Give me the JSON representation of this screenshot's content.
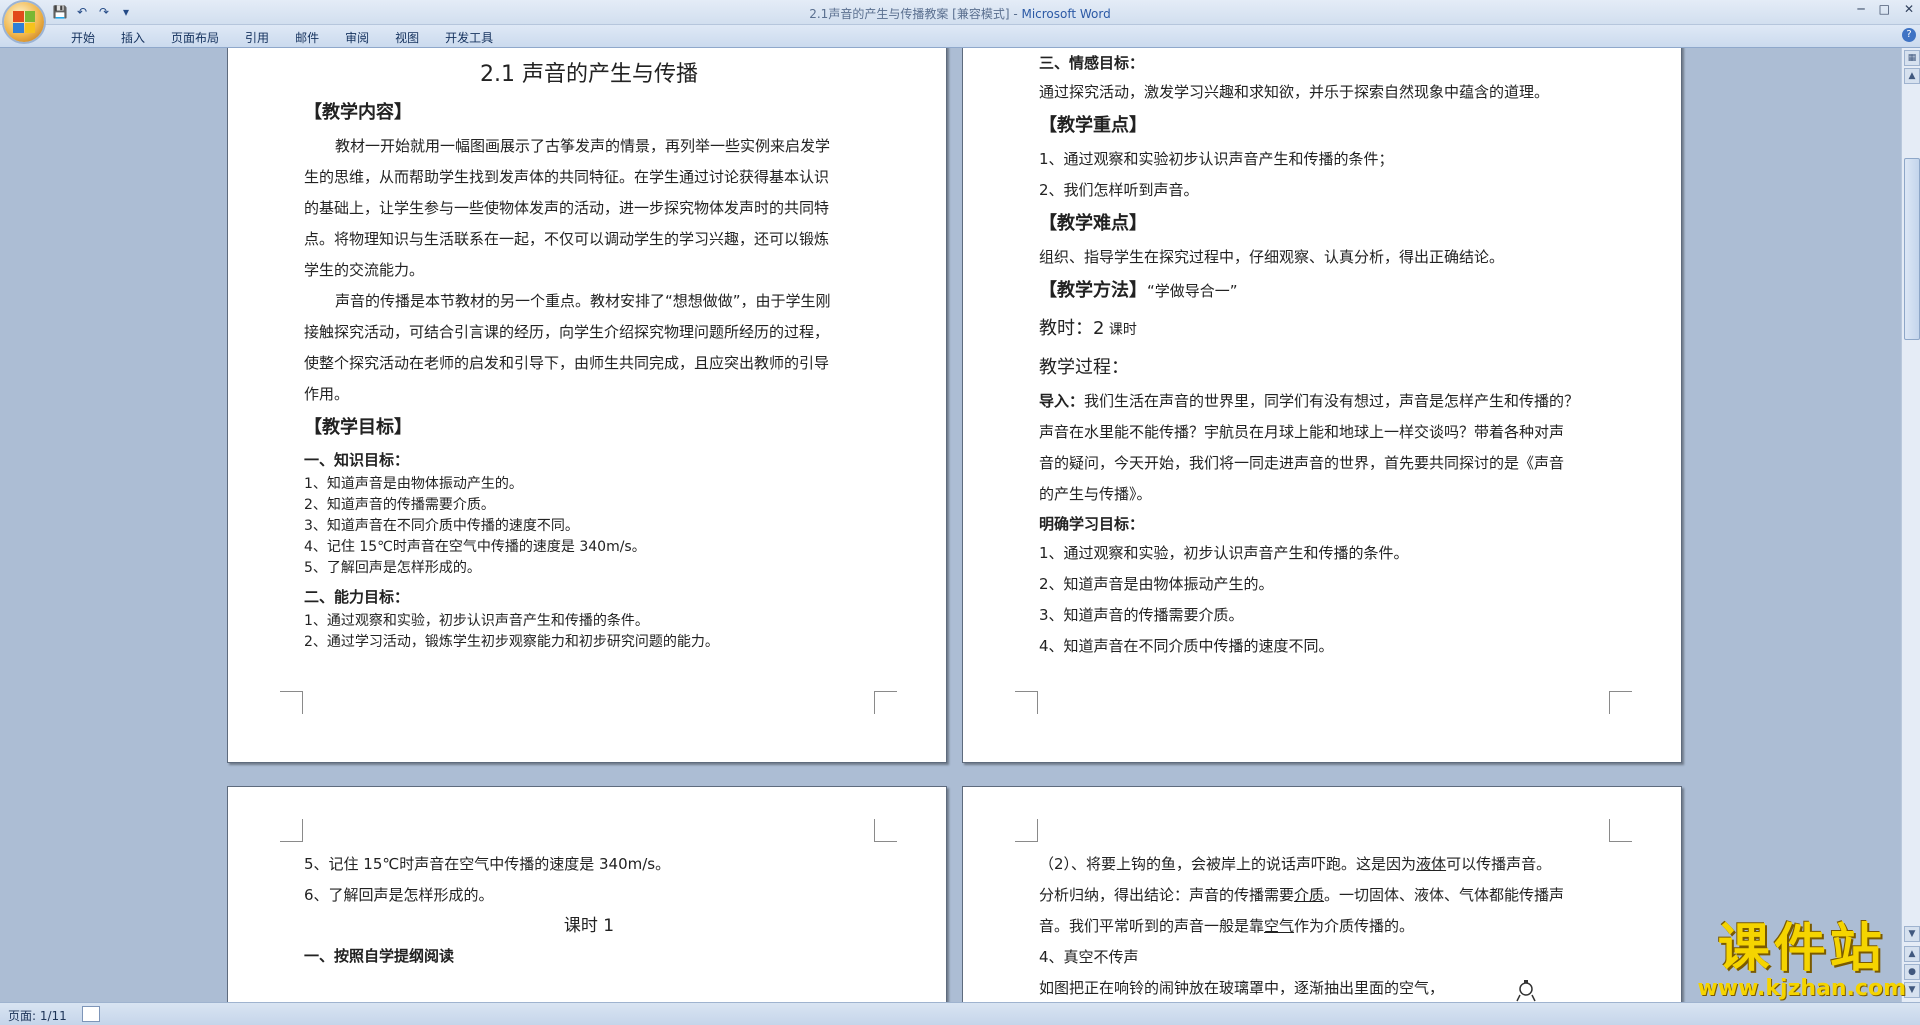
{
  "window": {
    "title": "2.1声音的产生与传播教案 [兼容模式]",
    "app_name": "Microsoft Word",
    "sep": " - "
  },
  "ribbon": {
    "tabs": [
      "开始",
      "插入",
      "页面布局",
      "引用",
      "邮件",
      "审阅",
      "视图",
      "开发工具"
    ]
  },
  "page1": {
    "title": "2.1  声音的产生与传播",
    "h_content": "【教学内容】",
    "para1": [
      "教材一开始就用一幅图画展示了古筝发声的情景，再列举一些实例来启发学",
      "生的思维，从而帮助学生找到发声体的共同特征。在学生通过讨论获得基本认识",
      "的基础上，让学生参与一些使物体发声的活动，进一步探究物体发声时的共同特",
      "点。将物理知识与生活联系在一起，不仅可以调动学生的学习兴趣，还可以锻炼",
      "学生的交流能力。"
    ],
    "para2": [
      "声音的传播是本节教材的另一个重点。教材安排了“想想做做”，由于学生刚",
      "接触探究活动，可结合引言课的经历，向学生介绍探究物理问题所经历的过程，",
      "使整个探究活动在老师的启发和引导下，由师生共同完成，且应突出教师的引导",
      "作用。"
    ],
    "h_goals": "【教学目标】",
    "sub1": "一、知识目标：",
    "knowledge": [
      "1、知道声音是由物体振动产生的。",
      "2、知道声音的传播需要介质。",
      "3、知道声音在不同介质中传播的速度不同。",
      "4、记住 15℃时声音在空气中传播的速度是 340m/s。",
      "5、了解回声是怎样形成的。"
    ],
    "sub2": "二、能力目标：",
    "ability": [
      "1、通过观察和实验，初步认识声音产生和传播的条件。",
      "2、通过学习活动，锻炼学生初步观察能力和初步研究问题的能力。"
    ]
  },
  "page2": {
    "sub3": "三、情感目标：",
    "emotion": "通过探究活动，激发学习兴趣和求知欲，并乐于探索自然现象中蕴含的道理。",
    "h_key": "【教学重点】",
    "key": [
      "1、通过观察和实验初步认识声音产生和传播的条件；",
      "2、我们怎样听到声音。"
    ],
    "h_diff": "【教学难点】",
    "diff": "组织、指导学生在探究过程中，仔细观察、认真分析，得出正确结论。",
    "h_method": "【教学方法】",
    "method": "“学做导合一”",
    "hours_label": "教时：2",
    "hours_unit": " 课时",
    "process": "教学过程：",
    "intro_label": "导入：",
    "intro": [
      "我们生活在声音的世界里，同学们有没有想过，声音是怎样产生和传播的？",
      "声音在水里能不能传播？宇航员在月球上能和地球上一样交谈吗？带着各种对声",
      "音的疑问，今天开始，我们将一同走进声音的世界，首先要共同探讨的是《声音",
      "的产生与传播》。"
    ],
    "goal_label": "明确学习目标：",
    "goals": [
      "1、通过观察和实验，初步认识声音产生和传播的条件。",
      "2、知道声音是由物体振动产生的。",
      "3、知道声音的传播需要介质。",
      "4、知道声音在不同介质中传播的速度不同。"
    ]
  },
  "page3": {
    "lines": [
      "5、记住 15℃时声音在空气中传播的速度是 340m/s。",
      "6、了解回声是怎样形成的。"
    ],
    "lesson": "课时 1",
    "step1": "一、按照自学提纲阅读"
  },
  "page4": {
    "l1_a": "（2）、将要上钩的鱼，会被岸上的说话声吓跑。这是因为",
    "l1_u": "液体",
    "l1_b": "可以传播声音。",
    "l2_a": "分析归纳，得出结论：声音的传播需要",
    "l2_u": "介质",
    "l2_b": "。一切固体、液体、气体都能传播声",
    "l3_a": "音。我们平常听到的声音一般是靠",
    "l3_u": "空气",
    "l3_b": "作为介质传播的。",
    "l4": "4、真空不传声",
    "l5": "如图把正在响铃的闹钟放在玻璃罩中，逐渐抽出里面的空气，"
  },
  "status": {
    "page": "页面: 1/11"
  },
  "watermark": {
    "text": "课件站",
    "url": "www.kjzhan.com"
  },
  "colors": {
    "workspace": "#acbdd4",
    "ribbon": "#cbdaee",
    "watermark": "#f5d400"
  }
}
